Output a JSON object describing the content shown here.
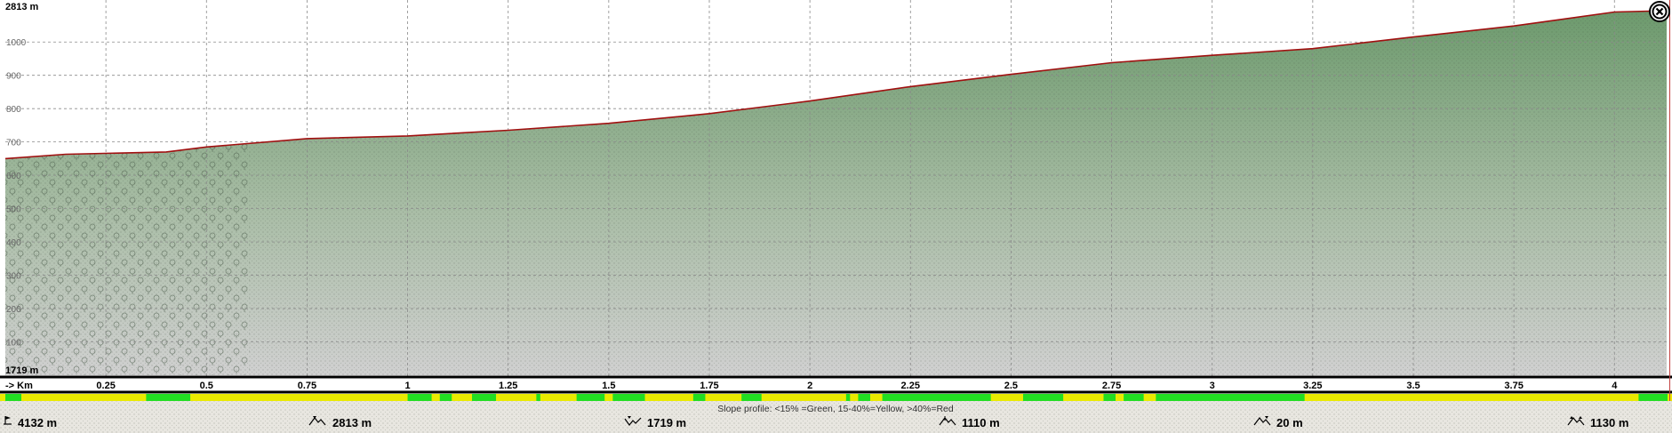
{
  "profile": {
    "max_label": "2813 m",
    "min_label": "1719 m",
    "y_ticks": [
      "1000",
      "900",
      "800",
      "700",
      "600",
      "500",
      "400",
      "300",
      "200",
      "100"
    ],
    "x_axis_label": "-> Km",
    "x_ticks": [
      "0.25",
      "0.5",
      "0.75",
      "1",
      "1.25",
      "1.5",
      "1.75",
      "2",
      "2.25",
      "2.5",
      "2.75",
      "3",
      "3.25",
      "3.5",
      "3.75",
      "4"
    ],
    "slope_caption": "Slope profile: <15% =Green, 15-40%=Yellow, >40%=Red",
    "colors": {
      "line": "#a01010",
      "fill_top": "#6d9a6d",
      "fill_bottom": "#d0d0d0",
      "grid": "#8a8a8a",
      "slope_green": "#22dd22",
      "slope_yellow": "#eaea00",
      "slope_red": "#e01010",
      "footer_bg": "#e8e6e0"
    }
  },
  "chart_data": {
    "type": "area",
    "xlabel": "-> Km",
    "ylabel": "",
    "xlim": [
      0,
      4.132
    ],
    "ylim": [
      0,
      1094
    ],
    "x": [
      0,
      0.15,
      0.4,
      0.5,
      0.75,
      1.0,
      1.25,
      1.5,
      1.75,
      2.0,
      2.25,
      2.5,
      2.75,
      3.0,
      3.25,
      3.5,
      3.75,
      4.0,
      4.132
    ],
    "series": [
      {
        "values": [
          650,
          663,
          670,
          685,
          710,
          718,
          735,
          756,
          785,
          823,
          866,
          903,
          938,
          960,
          980,
          1015,
          1048,
          1090,
          1094
        ]
      }
    ]
  },
  "slope_segments": [
    [
      "g",
      0,
      0.04
    ],
    [
      "y",
      0.04,
      0.35
    ],
    [
      "g",
      0.35,
      0.46
    ],
    [
      "y",
      0.46,
      1.0
    ],
    [
      "g",
      1.0,
      1.06
    ],
    [
      "y",
      1.06,
      1.08
    ],
    [
      "g",
      1.08,
      1.11
    ],
    [
      "y",
      1.11,
      1.16
    ],
    [
      "g",
      1.16,
      1.22
    ],
    [
      "y",
      1.22,
      1.32
    ],
    [
      "g",
      1.32,
      1.33
    ],
    [
      "y",
      1.33,
      1.42
    ],
    [
      "g",
      1.42,
      1.49
    ],
    [
      "y",
      1.49,
      1.51
    ],
    [
      "g",
      1.51,
      1.59
    ],
    [
      "y",
      1.59,
      1.71
    ],
    [
      "g",
      1.71,
      1.74
    ],
    [
      "y",
      1.74,
      1.83
    ],
    [
      "g",
      1.83,
      1.88
    ],
    [
      "y",
      1.88,
      2.09
    ],
    [
      "g",
      2.09,
      2.1
    ],
    [
      "y",
      2.1,
      2.12
    ],
    [
      "g",
      2.12,
      2.15
    ],
    [
      "y",
      2.15,
      2.18
    ],
    [
      "g",
      2.18,
      2.45
    ],
    [
      "y",
      2.45,
      2.53
    ],
    [
      "g",
      2.53,
      2.63
    ],
    [
      "y",
      2.63,
      2.73
    ],
    [
      "g",
      2.73,
      2.76
    ],
    [
      "y",
      2.76,
      2.78
    ],
    [
      "g",
      2.78,
      2.83
    ],
    [
      "y",
      2.83,
      2.86
    ],
    [
      "g",
      2.86,
      3.23
    ],
    [
      "y",
      3.23,
      4.06
    ],
    [
      "g",
      4.06,
      4.132
    ]
  ],
  "stats": [
    {
      "icon": "distance-icon",
      "value": "4132 m"
    },
    {
      "icon": "max-elevation-icon",
      "value": "2813 m"
    },
    {
      "icon": "min-elevation-icon",
      "value": "1719 m"
    },
    {
      "icon": "elevation-range-icon",
      "value": "1110 m"
    },
    {
      "icon": "descent-icon",
      "value": "20 m"
    },
    {
      "icon": "ascent-icon",
      "value": "1130 m"
    }
  ]
}
